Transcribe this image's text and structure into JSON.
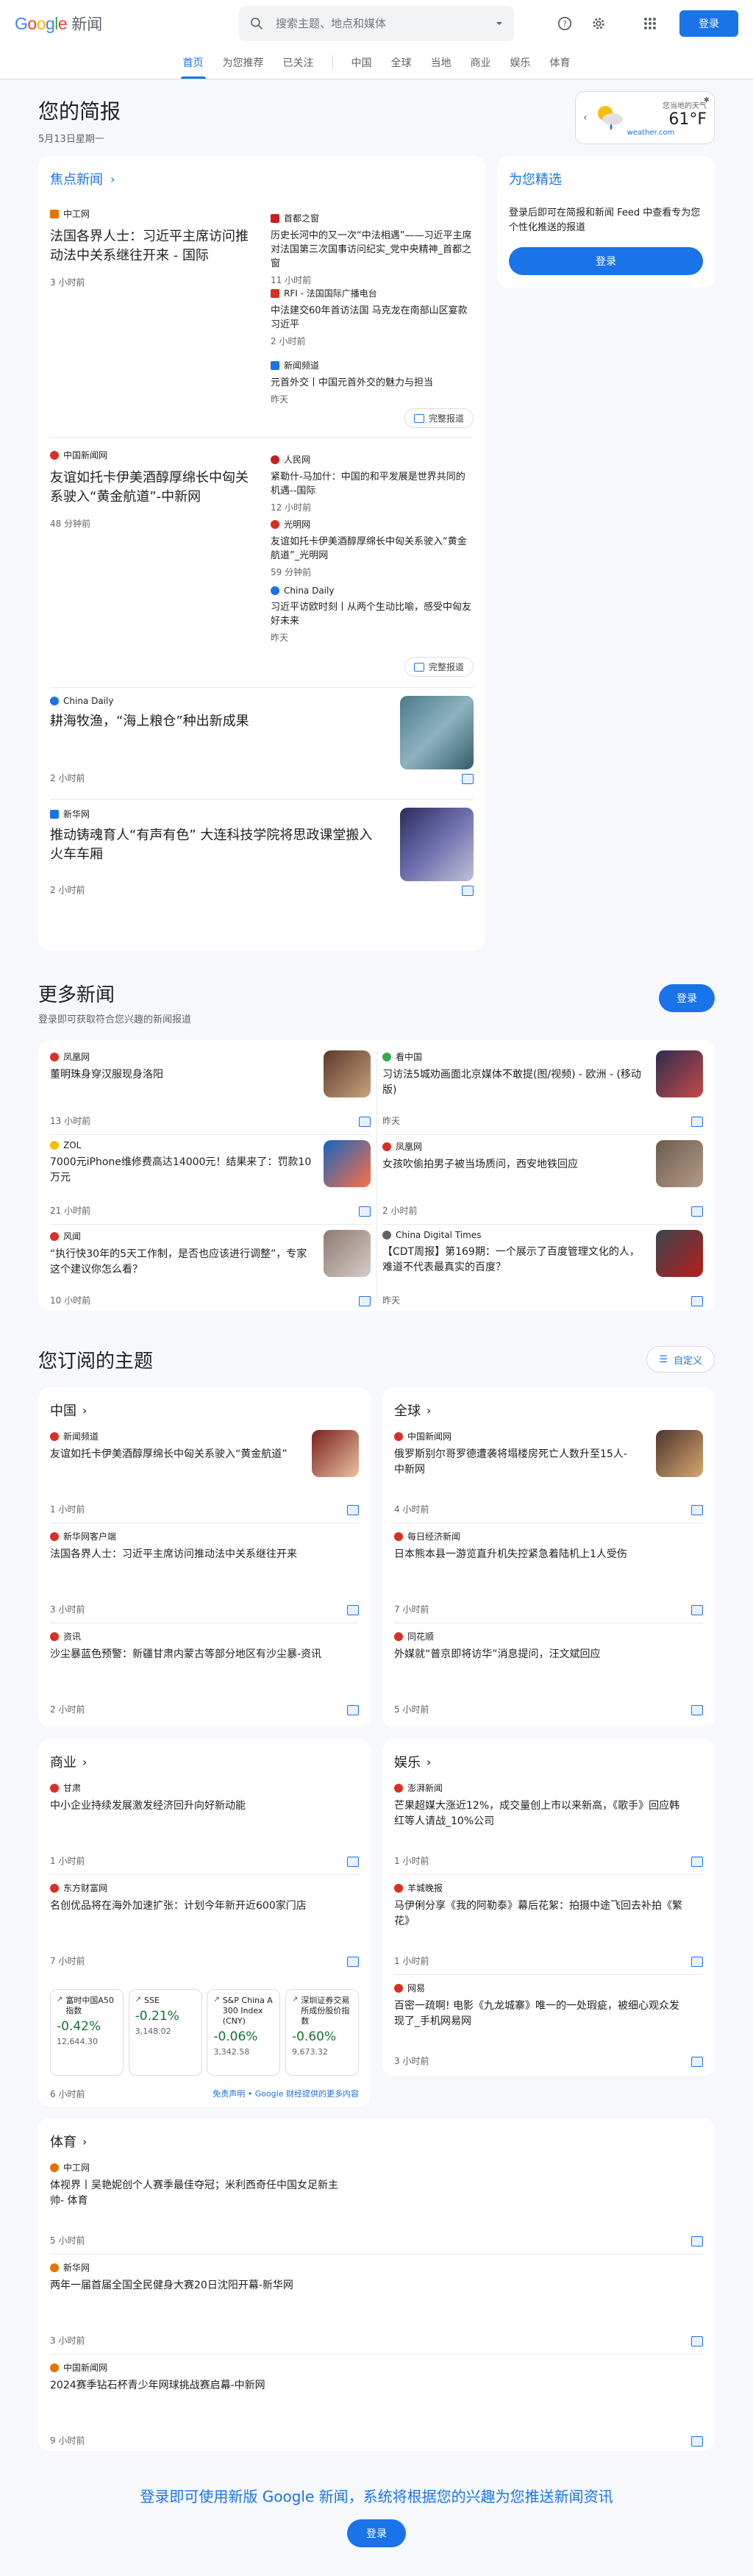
{
  "header": {
    "logo_google": "Google",
    "logo_news": "新闻",
    "search_placeholder": "搜索主题、地点和媒体",
    "login": "登录"
  },
  "nav": {
    "tabs": [
      "首页",
      "为您推荐",
      "已关注",
      "中国",
      "全球",
      "当地",
      "商业",
      "娱乐",
      "体育"
    ]
  },
  "briefing": {
    "title": "您的简报",
    "date": "5月13日星期一"
  },
  "weather": {
    "label": "您当地的天气",
    "temp": "61°F",
    "source": "weather.com"
  },
  "headlines": {
    "title": "焦点新闻",
    "clusters": [
      {
        "main": {
          "source": "中工网",
          "title": "法国各界人士：习近平主席访问推动法中关系继往开来 - 国际",
          "time": "3 小时前"
        },
        "subs": [
          {
            "source": "首都之窗",
            "title": "历史长河中的又一次“中法相遇”——习近平主席对法国第三次国事访问纪实_党中央精神_首都之窗",
            "time": "11 小时前"
          },
          {
            "source": "RFI - 法国国际广播电台",
            "title": "中法建交60年首访法国 马克龙在南部山区宴款习近平",
            "time": "2 小时前"
          },
          {
            "source": "新闻频道",
            "title": "元首外交丨中国元首外交的魅力与担当",
            "time": "昨天"
          }
        ],
        "full": "完整报道"
      },
      {
        "main": {
          "source": "中国新闻网",
          "title": "友谊如托卡伊美酒醇厚绵长中匈关系驶入“黄金航道”-中新网",
          "time": "48 分钟前"
        },
        "subs": [
          {
            "source": "人民网",
            "title": "紧勒什-马加什：中国的和平发展是世界共同的机遇--国际",
            "time": "12 小时前"
          },
          {
            "source": "光明网",
            "title": "友谊如托卡伊美酒醇厚绵长中匈关系驶入“黄金航道”_光明网",
            "time": "59 分钟前"
          },
          {
            "source": "China Daily",
            "title": "习近平访欧时刻丨从两个生动比喻，感受中匈友好未来",
            "time": "昨天"
          }
        ],
        "full": "完整报道"
      }
    ],
    "singles": [
      {
        "source": "China Daily",
        "title": "耕海牧渔，“海上粮仓”种出新成果",
        "time": "2 小时前"
      },
      {
        "source": "新华网",
        "title": "推动铸魂育人“有声有色” 大连科技学院将思政课堂搬入火车车厢",
        "time": "2 小时前"
      }
    ]
  },
  "picks": {
    "title": "为您精选",
    "desc": "登录后即可在简报和新闻 Feed 中查看专为您个性化推送的报道",
    "login": "登录"
  },
  "more": {
    "title": "更多新闻",
    "sub": "登录即可获取符合您兴趣的新闻报道",
    "login": "登录",
    "items": [
      {
        "source": "凤凰网",
        "title": "董明珠身穿汉服现身洛阳",
        "time": "13 小时前"
      },
      {
        "source": "看中国",
        "title": "习访法5城劝画面北京媒体不敢提(图/视频) - 欧洲 - (移动版)",
        "time": "昨天"
      },
      {
        "source": "ZOL",
        "title": "7000元iPhone维修费高达14000元！结果来了：罚款10万元",
        "time": "21 小时前"
      },
      {
        "source": "凤凰网",
        "title": "女孩吹偷拍男子被当场质问，西安地铁回应",
        "time": "2 小时前"
      },
      {
        "source": "风闻",
        "title": "“执行快30年的5天工作制，是否也应该进行调整”，专家这个建议你怎么看？",
        "time": "10 小时前"
      },
      {
        "source": "China Digital Times",
        "title": "【CDT周报】第169期：一个展示了百度管理文化的人，难道不代表最真实的百度？",
        "time": "昨天"
      }
    ]
  },
  "topics": {
    "title": "您订阅的主题",
    "customize": "自定义",
    "china": {
      "title": "中国",
      "items": [
        {
          "source": "新闻频道",
          "title": "友谊如托卡伊美酒醇厚绵长中匈关系驶入“黄金航道”",
          "time": "1 小时前"
        },
        {
          "source": "新华网客户端",
          "title": "法国各界人士：习近平主席访问推动法中关系继往开来",
          "time": "3 小时前"
        },
        {
          "source": "资讯",
          "title": "沙尘暴蓝色预警：新疆甘肃内蒙古等部分地区有沙尘暴-资讯",
          "time": "2 小时前"
        }
      ]
    },
    "world": {
      "title": "全球",
      "items": [
        {
          "source": "中国新闻网",
          "title": "俄罗斯别尔哥罗德遭袭将塌楼房死亡人数升至15人-中新网",
          "time": "4 小时前"
        },
        {
          "source": "每日经济新闻",
          "title": "日本熊本县一游览直升机失控紧急着陆机上1人受伤",
          "time": "7 小时前"
        },
        {
          "source": "同花顺",
          "title": "外媒就“普京即将访华”消息提问，汪文斌回应",
          "time": "5 小时前"
        }
      ]
    },
    "business": {
      "title": "商业",
      "items": [
        {
          "source": "甘肃",
          "title": "中小企业持续发展激发经济回升向好新动能",
          "time": "1 小时前"
        },
        {
          "source": "东方财富网",
          "title": "名创优品将在海外加速扩张：计划今年新开近600家门店",
          "time": "7 小时前"
        }
      ],
      "stocks": [
        {
          "name": "富时中国A50指数",
          "pct": "-0.42%",
          "value": "12,644.30"
        },
        {
          "name": "SSE",
          "pct": "-0.21%",
          "value": "3,148.02"
        },
        {
          "name": "S&P China A 300 Index (CNY)",
          "pct": "-0.06%",
          "value": "3,342.58"
        },
        {
          "name": "深圳证券交易所成份股价指数",
          "pct": "-0.60%",
          "value": "9,673.32"
        }
      ],
      "last_time": "6 小时前",
      "disclaimer": "免责声明 • Google 财经提供的更多内容"
    },
    "ent": {
      "title": "娱乐",
      "items": [
        {
          "source": "澎湃新闻",
          "title": "芒果超媒大涨近12%，成交量创上市以来新高，《歌手》回应韩红等人请战_10%公司",
          "time": "1 小时前"
        },
        {
          "source": "羊城晚报",
          "title": "马伊俐分享《我的阿勒泰》幕后花絮：拍摄中途飞回去补拍《繁花》",
          "time": "1 小时前"
        },
        {
          "source": "网易",
          "title": "百密一疏啊! 电影《九龙城寨》唯一的一处瑕疵，被细心观众发现了_手机网易网",
          "time": "3 小时前"
        }
      ]
    },
    "sports": {
      "title": "体育",
      "items": [
        {
          "source": "中工网",
          "title": "体视界丨吴艳妮创个人赛季最佳夺冠；米利西奇任中国女足新主帅- 体育",
          "time": "5 小时前"
        },
        {
          "source": "新华网",
          "title": "两年一届首届全国全民健身大赛20日沈阳开幕-新华网",
          "time": "3 小时前"
        },
        {
          "source": "中国新闻网",
          "title": "2024赛季钻石杯青少年网球挑战赛启幕-中新网",
          "time": "9 小时前"
        }
      ]
    }
  },
  "footer": {
    "cta": "登录即可使用新版 Google 新闻，系统将根据您的兴趣为您推送新闻资讯",
    "login": "登录"
  }
}
